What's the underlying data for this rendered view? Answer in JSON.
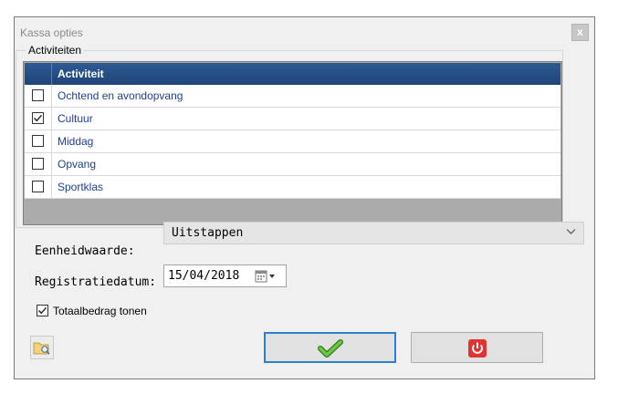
{
  "window": {
    "title": "Kassa opties",
    "close_label": "x"
  },
  "activities": {
    "group_label": "Activiteiten",
    "column_header": "Activiteit",
    "rows": [
      {
        "label": "Ochtend en avondopvang",
        "checked": false
      },
      {
        "label": "Cultuur",
        "checked": true
      },
      {
        "label": "Middag",
        "checked": false
      },
      {
        "label": "Opvang",
        "checked": false
      },
      {
        "label": "Sportklas",
        "checked": false
      }
    ]
  },
  "unit_value": {
    "label": "Eenheidwaarde:",
    "value": "Uitstappen"
  },
  "registration_date": {
    "label": "Registratiedatum:",
    "value": "15/04/2018"
  },
  "show_total": {
    "label": "Totaalbedrag tonen",
    "checked": true
  },
  "buttons": {
    "ok_icon": "checkmark-icon",
    "cancel_icon": "power-icon",
    "search_icon": "folder-search-icon"
  },
  "colors": {
    "header": "#1f4478",
    "row_text": "#1f3f8f",
    "ok_border": "#2b7fd0",
    "power_red": "#e23333",
    "check_green": "#4caf30"
  }
}
